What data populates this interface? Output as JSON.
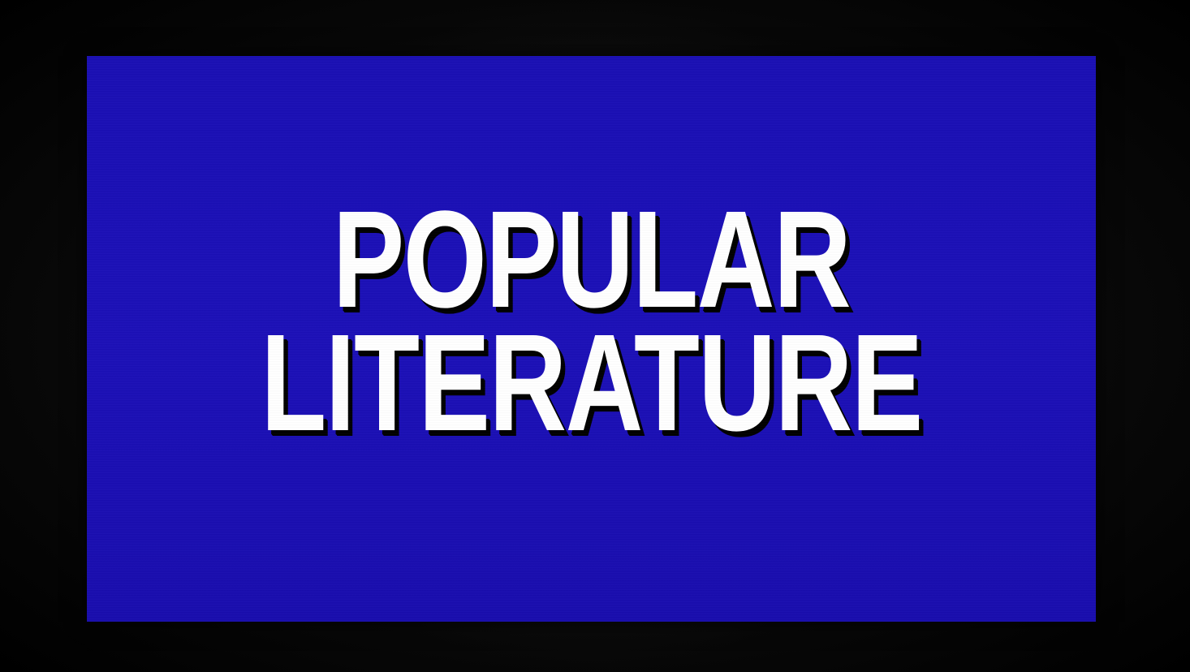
{
  "board": {
    "background_color": "#1a0fb4",
    "text_color": "#ffffff",
    "category_lines": [
      "POPULAR",
      "LITERATURE"
    ]
  }
}
